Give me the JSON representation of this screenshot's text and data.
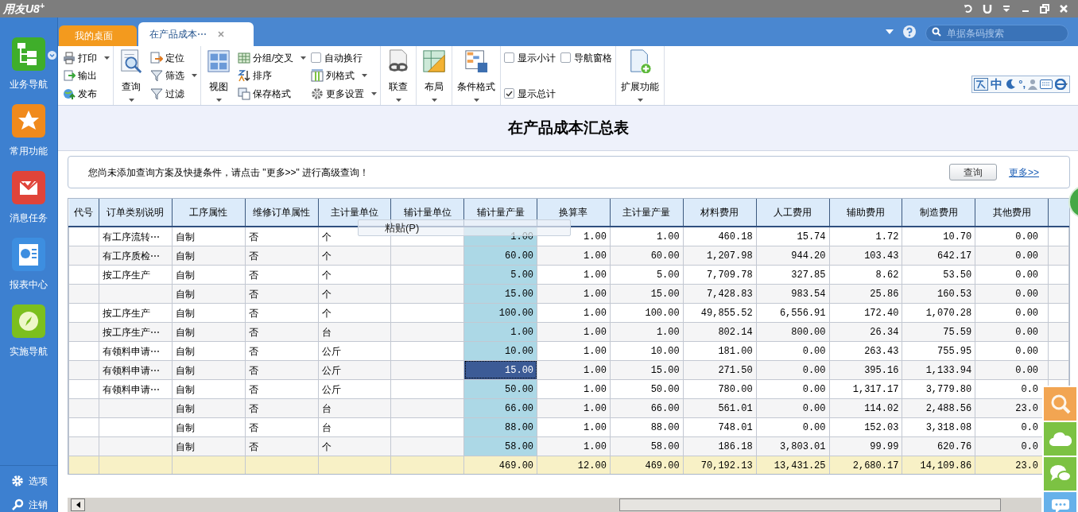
{
  "app": {
    "logo": "用友U8$^{+}$"
  },
  "tabs": [
    {
      "label": "我的桌面",
      "selected": false,
      "closable": false
    },
    {
      "label": "在产品成本⋯",
      "selected": true,
      "closable": true
    }
  ],
  "search": {
    "placeholder": "单据条码搜索"
  },
  "sidebar": {
    "items": [
      {
        "label": "业务导航",
        "color": "#3fae2a"
      },
      {
        "label": "常用功能",
        "color": "#f08a1c"
      },
      {
        "label": "消息任务",
        "color": "#e0443a"
      },
      {
        "label": "报表中心",
        "color": "#3d8ee0"
      },
      {
        "label": "实施导航",
        "color": "#7cbf1e"
      }
    ],
    "bottom": [
      {
        "label": "选项"
      },
      {
        "label": "注销"
      }
    ]
  },
  "toolbar": [
    {
      "columns": [
        [
          {
            "kind": "small",
            "label": "打印",
            "dropdown": true
          },
          {
            "kind": "small",
            "label": "输出",
            "dropdown": false
          },
          {
            "kind": "small",
            "label": "发布",
            "dropdown": false
          }
        ]
      ]
    },
    {
      "columns": [
        [
          {
            "kind": "large",
            "label": "查询",
            "dropdown": true
          }
        ],
        [
          {
            "kind": "small",
            "label": "定位",
            "dropdown": false
          },
          {
            "kind": "small",
            "label": "筛选",
            "dropdown": true
          },
          {
            "kind": "small",
            "label": "过滤",
            "dropdown": false
          }
        ]
      ]
    },
    {
      "columns": [
        [
          {
            "kind": "large",
            "label": "视图",
            "dropdown": true
          }
        ],
        [
          {
            "kind": "small",
            "label": "分组/交叉",
            "dropdown": true
          },
          {
            "kind": "small",
            "label": "排序",
            "dropdown": false
          },
          {
            "kind": "small",
            "label": "保存格式",
            "dropdown": false
          }
        ],
        [
          {
            "kind": "checkbox",
            "label": "自动换行",
            "checked": false
          },
          {
            "kind": "small",
            "label": "列格式",
            "dropdown": true
          },
          {
            "kind": "small",
            "label": "更多设置",
            "dropdown": true
          }
        ]
      ]
    },
    {
      "columns": [
        [
          {
            "kind": "large",
            "label": "联查",
            "dropdown": true
          }
        ]
      ]
    },
    {
      "columns": [
        [
          {
            "kind": "large",
            "label": "布局",
            "dropdown": true
          }
        ]
      ]
    },
    {
      "columns": [
        [
          {
            "kind": "large",
            "label": "条件格式",
            "dropdown": true
          }
        ]
      ]
    },
    {
      "columns": [
        [
          {
            "kind": "checkbox",
            "label": "显示小计",
            "checked": false
          },
          {
            "kind": "checkbox",
            "label": "显示总计",
            "checked": true
          }
        ],
        [
          {
            "kind": "checkbox",
            "label": "导航窗格",
            "checked": false
          }
        ]
      ]
    },
    {
      "columns": [
        [
          {
            "kind": "large",
            "label": "扩展功能",
            "dropdown": true
          }
        ]
      ]
    }
  ],
  "ime": {
    "mode": "中",
    "punctuation": "°,"
  },
  "report": {
    "title": "在产品成本汇总表",
    "notice": "您尚未添加查询方案及快捷条件，请点击 \"更多>>\" 进行高级查询！",
    "query_button": "查询",
    "more_link": "更多>>"
  },
  "table": {
    "columns": [
      {
        "label": "代号",
        "kind": "text",
        "highlighted": false
      },
      {
        "label": "订单类别说明",
        "kind": "text",
        "highlighted": false
      },
      {
        "label": "工序属性",
        "kind": "text",
        "highlighted": false
      },
      {
        "label": "维修订单属性",
        "kind": "text",
        "highlighted": false
      },
      {
        "label": "主计量单位",
        "kind": "text",
        "highlighted": false
      },
      {
        "label": "辅计量单位",
        "kind": "text",
        "highlighted": false
      },
      {
        "label": "辅计量产量",
        "kind": "number",
        "highlighted": true
      },
      {
        "label": "换算率",
        "kind": "number",
        "highlighted": false
      },
      {
        "label": "主计量产量",
        "kind": "number",
        "highlighted": false
      },
      {
        "label": "材料费用",
        "kind": "number",
        "highlighted": false
      },
      {
        "label": "人工费用",
        "kind": "number",
        "highlighted": false
      },
      {
        "label": "辅助费用",
        "kind": "number",
        "highlighted": false
      },
      {
        "label": "制造费用",
        "kind": "number",
        "highlighted": false
      },
      {
        "label": "其他费用",
        "kind": "number",
        "highlighted": false
      }
    ],
    "rows": [
      {
        "cells": [
          null,
          "有工序流转⋯",
          "自制",
          "否",
          "个",
          null,
          "1.00",
          "1.00",
          "1.00",
          "460.18",
          "15.74",
          "1.72",
          "10.70",
          "0.00"
        ],
        "cell_selected": false
      },
      {
        "cells": [
          null,
          "有工序质检⋯",
          "自制",
          "否",
          "个",
          null,
          "60.00",
          "1.00",
          "60.00",
          "1,207.98",
          "944.20",
          "103.43",
          "642.17",
          "0.00"
        ],
        "cell_selected": false
      },
      {
        "cells": [
          null,
          "按工序生产",
          "自制",
          "否",
          "个",
          null,
          "5.00",
          "1.00",
          "5.00",
          "7,709.78",
          "327.85",
          "8.62",
          "53.50",
          "0.00"
        ],
        "cell_selected": false
      },
      {
        "cells": [
          null,
          null,
          "自制",
          "否",
          "个",
          null,
          "15.00",
          "1.00",
          "15.00",
          "7,428.83",
          "983.54",
          "25.86",
          "160.53",
          "0.00"
        ],
        "cell_selected": false
      },
      {
        "cells": [
          null,
          "按工序生产",
          "自制",
          "否",
          "个",
          null,
          "100.00",
          "1.00",
          "100.00",
          "49,855.52",
          "6,556.91",
          "172.40",
          "1,070.28",
          "0.00"
        ],
        "cell_selected": false
      },
      {
        "cells": [
          null,
          "按工序生产⋯",
          "自制",
          "否",
          "台",
          null,
          "1.00",
          "1.00",
          "1.00",
          "802.14",
          "800.00",
          "26.34",
          "75.59",
          "0.00"
        ],
        "cell_selected": false
      },
      {
        "cells": [
          null,
          "有领料申请⋯",
          "自制",
          "否",
          "公斤",
          null,
          "10.00",
          "1.00",
          "10.00",
          "181.00",
          "0.00",
          "263.43",
          "755.95",
          "0.00"
        ],
        "cell_selected": false
      },
      {
        "cells": [
          null,
          "有领料申请⋯",
          "自制",
          "否",
          "公斤",
          null,
          "15.00",
          "1.00",
          "15.00",
          "271.50",
          "0.00",
          "395.16",
          "1,133.94",
          "0.00"
        ],
        "cell_selected": true
      },
      {
        "cells": [
          null,
          "有领料申请⋯",
          "自制",
          "否",
          "公斤",
          null,
          "50.00",
          "1.00",
          "50.00",
          "780.00",
          "0.00",
          "1,317.17",
          "3,779.80",
          "0.0"
        ],
        "cell_selected": false
      },
      {
        "cells": [
          null,
          null,
          "自制",
          "否",
          "台",
          null,
          "66.00",
          "1.00",
          "66.00",
          "561.01",
          "0.00",
          "114.02",
          "2,488.56",
          "23.0"
        ],
        "cell_selected": false
      },
      {
        "cells": [
          null,
          null,
          "自制",
          "否",
          "台",
          null,
          "88.00",
          "1.00",
          "88.00",
          "748.01",
          "0.00",
          "152.03",
          "3,318.08",
          "0.0"
        ],
        "cell_selected": false
      },
      {
        "cells": [
          null,
          null,
          "自制",
          "否",
          "个",
          null,
          "58.00",
          "1.00",
          "58.00",
          "186.18",
          "3,803.01",
          "99.99",
          "620.76",
          "0.0"
        ],
        "cell_selected": false
      }
    ],
    "total": {
      "cells": [
        null,
        null,
        null,
        null,
        null,
        null,
        "469.00",
        "12.00",
        "469.00",
        "70,192.13",
        "13,431.25",
        "2,680.17",
        "14,109.86",
        "23.0"
      ]
    }
  },
  "context_menu": {
    "items": [
      {
        "label": "粘贴(P)"
      }
    ]
  }
}
